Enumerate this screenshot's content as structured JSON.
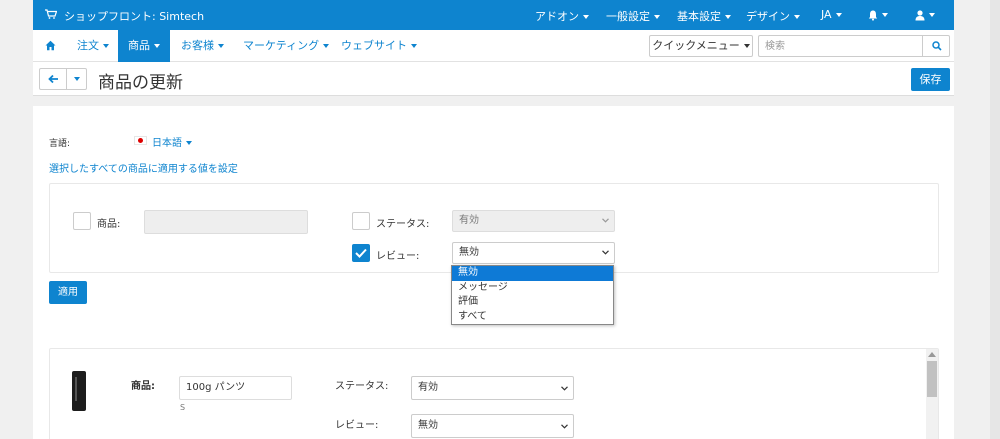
{
  "topbar": {
    "store_name": "ショップフロント: Simtech",
    "menus": [
      "アドオン",
      "一般設定",
      "基本設定",
      "デザイン",
      "JA"
    ]
  },
  "navbar": {
    "items": [
      "注文",
      "商品",
      "お客様",
      "マーケティング",
      "ウェブサイト"
    ],
    "active": "商品",
    "quick_menu": "クイックメニュー",
    "search_placeholder": "検索"
  },
  "page": {
    "title": "商品の更新",
    "save_label": "保存"
  },
  "language": {
    "label": "言語:",
    "value": "日本語"
  },
  "bulk": {
    "link": "選択したすべての商品に適用する値を設定",
    "product_label": "商品:",
    "status_label": "ステータス:",
    "status_value": "有効",
    "review_label": "レビュー:",
    "review_value": "無効",
    "review_options": [
      "無効",
      "メッセージ",
      "評価",
      "すべて"
    ],
    "apply_label": "適用"
  },
  "product_row": {
    "product_label": "商品:",
    "product_name": "100g パンツ",
    "product_sub": "S",
    "status_label": "ステータス:",
    "status_value": "有効",
    "review_label": "レビュー:",
    "review_value": "無効"
  },
  "colors": {
    "accent": "#0e84cf",
    "selected_option": "#0e7ad6"
  }
}
